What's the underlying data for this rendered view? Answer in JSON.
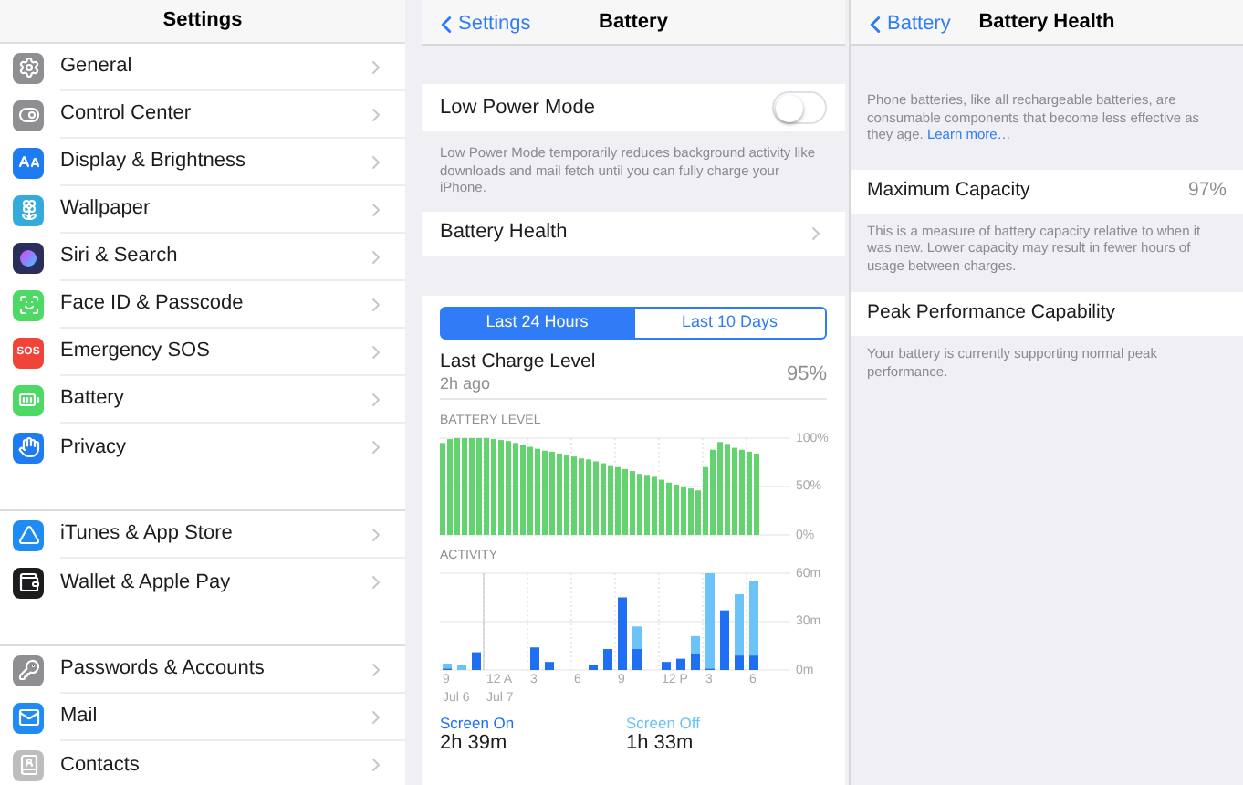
{
  "settings": {
    "title": "Settings",
    "groups": [
      [
        {
          "label": "General"
        },
        {
          "label": "Control Center"
        },
        {
          "label": "Display & Brightness"
        },
        {
          "label": "Wallpaper"
        },
        {
          "label": "Siri & Search"
        },
        {
          "label": "Face ID & Passcode"
        },
        {
          "label": "Emergency SOS",
          "badge": "SOS"
        },
        {
          "label": "Battery"
        },
        {
          "label": "Privacy"
        }
      ],
      [
        {
          "label": "iTunes & App Store"
        },
        {
          "label": "Wallet & Apple Pay"
        }
      ],
      [
        {
          "label": "Passwords & Accounts"
        },
        {
          "label": "Mail"
        },
        {
          "label": "Contacts"
        }
      ]
    ]
  },
  "battery": {
    "back": "Settings",
    "title": "Battery",
    "low_power": {
      "label": "Low Power Mode",
      "on": false,
      "note": "Low Power Mode temporarily reduces background activity like downloads and mail fetch until you can fully charge your iPhone."
    },
    "health_row": "Battery Health",
    "tabs": [
      {
        "label": "Last 24 Hours",
        "selected": true
      },
      {
        "label": "Last 10 Days",
        "selected": false
      }
    ],
    "last_charge": {
      "label": "Last Charge Level",
      "time": "2h ago",
      "value": "95%"
    },
    "battery_chart": {
      "chart_data": {
        "type": "bar",
        "title": "BATTERY LEVEL",
        "grid": true,
        "categories": [
          null,
          null,
          null,
          null,
          null,
          null,
          null,
          null,
          null,
          null,
          null,
          null,
          null,
          null,
          null,
          null,
          null,
          null,
          null,
          null,
          null,
          null,
          null,
          null,
          null,
          null,
          null,
          null,
          null,
          null,
          null,
          null,
          null,
          null,
          null,
          null,
          null,
          null,
          null,
          null,
          null,
          null,
          null,
          null,
          null,
          null,
          null,
          null
        ],
        "values": [
          95,
          99,
          100,
          100,
          100,
          100,
          100,
          99,
          98,
          97,
          95,
          93,
          91,
          89,
          87,
          86,
          84,
          83,
          81,
          79,
          78,
          76,
          74,
          72,
          70,
          68,
          66,
          63,
          62,
          60,
          57,
          54,
          52,
          50,
          48,
          46,
          70,
          88,
          96,
          94,
          90,
          88,
          86,
          84,
          null,
          null,
          null,
          null
        ],
        "ylim": [
          0,
          100
        ],
        "ref_lines": [
          {
            "axis": "y",
            "value": 50
          }
        ],
        "yticks": [
          {
            "value": 0,
            "label": "0%"
          },
          {
            "value": 50,
            "label": "50%"
          },
          {
            "value": 100,
            "label": "100%"
          }
        ]
      }
    },
    "activity_chart": {
      "chart_data": {
        "type": "bar",
        "title": "ACTIVITY",
        "stacked": true,
        "grid": true,
        "categories": [
          "9",
          null,
          null,
          "12 A",
          null,
          null,
          "3",
          null,
          null,
          "6",
          null,
          null,
          "9",
          null,
          null,
          "12 P",
          null,
          null,
          "3",
          null,
          null,
          "6",
          null,
          null
        ],
        "series": [
          {
            "name": "Screen On",
            "color": "#1f6ff2",
            "values": [
              1,
              0,
              11,
              0,
              0,
              0,
              14,
              5,
              0,
              0,
              3,
              13,
              45,
              13,
              0,
              5,
              7,
              10,
              1,
              37,
              9,
              9,
              0,
              0
            ]
          },
          {
            "name": "Screen Off",
            "color": "#6cc3f7",
            "values": [
              3,
              3,
              0,
              0,
              0,
              0,
              0,
              0,
              0,
              0,
              0,
              0,
              0,
              14,
              0,
              0,
              0,
              11,
              59,
              0,
              38,
              46,
              0,
              0
            ]
          }
        ],
        "ylim": [
          0,
          60
        ],
        "ref_lines": [
          {
            "axis": "y",
            "value": 30
          }
        ],
        "yticks": [
          {
            "value": 0,
            "label": "0m"
          },
          {
            "value": 30,
            "label": "30m"
          },
          {
            "value": 60,
            "label": "60m"
          }
        ],
        "annotations": [
          "Jul 6",
          "Jul 7"
        ]
      }
    },
    "totals": [
      {
        "value": "2h 39m"
      },
      {
        "value": "1h 33m"
      }
    ]
  },
  "health": {
    "back": "Battery",
    "title": "Battery Health",
    "intro": "Phone batteries, like all rechargeable batteries, are consumable components that become less effective as they age.",
    "link": "Learn more…",
    "rows": [
      {
        "label": "Maximum Capacity",
        "value": "97%",
        "note": "This is a measure of battery capacity relative to when it was new. Lower capacity may result in fewer hours of usage between charges."
      },
      {
        "label": "Peak Performance Capability",
        "note": "Your battery is currently supporting normal peak performance."
      }
    ]
  }
}
